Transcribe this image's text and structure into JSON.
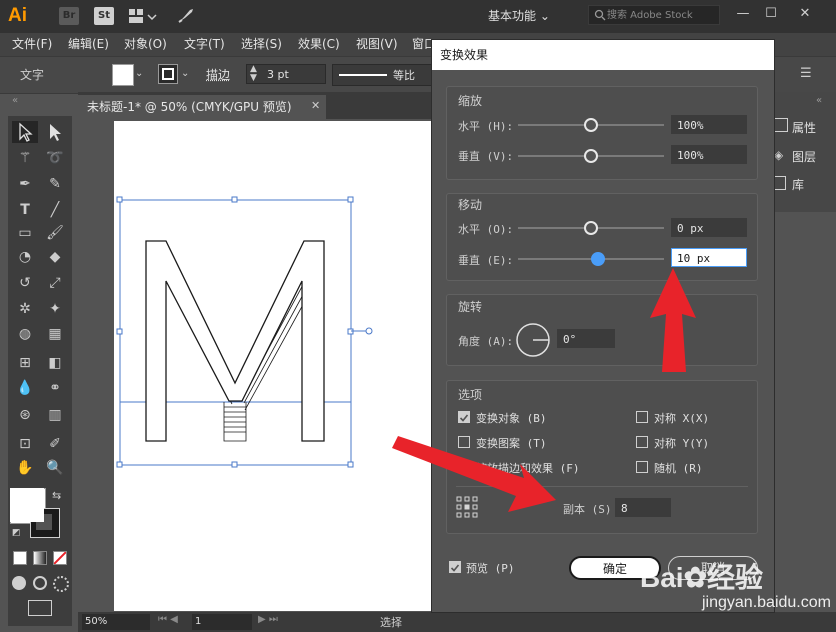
{
  "app": {
    "logo": "Ai",
    "br_badge": "Br",
    "st_badge": "St",
    "workspace": "基本功能",
    "search_placeholder": "搜索 Adobe Stock"
  },
  "menu": [
    "文件(F)",
    "编辑(E)",
    "对象(O)",
    "文字(T)",
    "选择(S)",
    "效果(C)",
    "视图(V)",
    "窗口"
  ],
  "control": {
    "label_text": "文字",
    "stroke_label": "描边",
    "stroke_value": "3 pt",
    "profile_label": "等比"
  },
  "document": {
    "tab_title": "未标题-1* @ 50% (CMYK/GPU 预览)",
    "zoom": "50%",
    "artboard_num": "1",
    "status_tool": "选择"
  },
  "panels": {
    "properties": "属性",
    "layers": "图层",
    "libraries": "库"
  },
  "dialog": {
    "title": "变换效果",
    "scale": {
      "title": "缩放",
      "h_label": "水平 (H):",
      "h_value": "100%",
      "v_label": "垂直 (V):",
      "v_value": "100%"
    },
    "move": {
      "title": "移动",
      "h_label": "水平 (O):",
      "h_value": "0 px",
      "v_label": "垂直 (E):",
      "v_value": "10 px"
    },
    "rotate": {
      "title": "旋转",
      "angle_label": "角度 (A):",
      "angle_value": "0°"
    },
    "options": {
      "title": "选项",
      "transform_objects": "变换对象 (B)",
      "transform_patterns": "变换图案 (T)",
      "scale_strokes": "缩放描边和效果 (F)",
      "reflect_x": "对称 X(X)",
      "reflect_y": "对称 Y(Y)",
      "random": "随机 (R)"
    },
    "copies_label": "副本 (S)",
    "copies_value": "8",
    "preview": "预览 (P)",
    "ok": "确定",
    "cancel": "取消"
  },
  "watermark": {
    "brand": "Bai",
    "brand2": "经验",
    "url": "jingyan.baidu.com"
  },
  "colors": {
    "accent": "#4a9df8",
    "arrow": "#e8232a",
    "ai_orange": "#ff9a00"
  }
}
